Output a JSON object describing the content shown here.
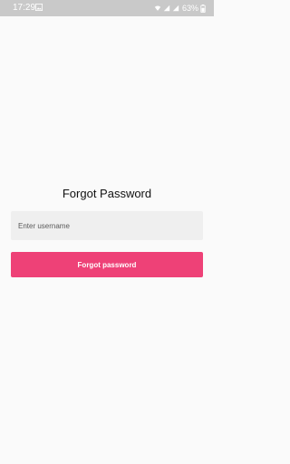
{
  "status_bar": {
    "time": "17:29",
    "battery_percent": "63%",
    "icons": [
      "gallery-icon",
      "wifi-icon",
      "signal-icon",
      "signal-icon",
      "battery-icon"
    ]
  },
  "screen": {
    "title": "Forgot Password",
    "username": {
      "value": "",
      "placeholder": "Enter username"
    },
    "submit_label": "Forgot password"
  },
  "colors": {
    "status_bar": "#c9c9c9",
    "background": "#fafafa",
    "input_background": "#efefef",
    "accent": "#ee4177"
  }
}
